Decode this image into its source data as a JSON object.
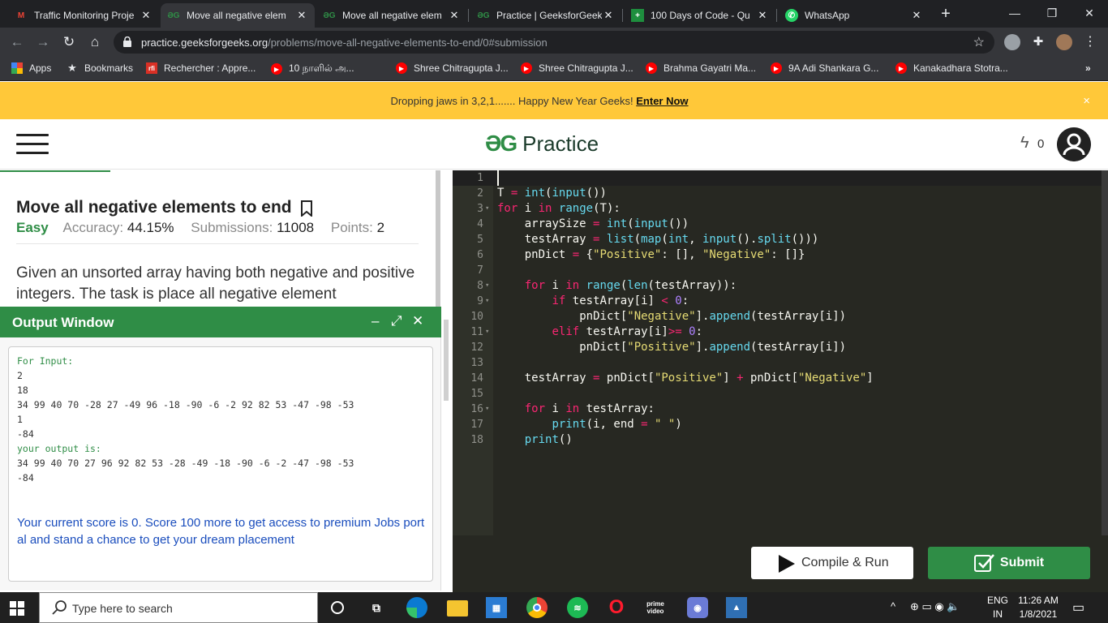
{
  "browser": {
    "tabs": [
      {
        "title": "Traffic Monitoring Proje",
        "favicon": "gmail-icon"
      },
      {
        "title": "Move all negative elem",
        "favicon": "gfg-icon"
      },
      {
        "title": "Move all negative elem",
        "favicon": "gfg-icon"
      },
      {
        "title": "Practice | GeeksforGeek",
        "favicon": "gfg-icon"
      },
      {
        "title": "100 Days of Code - Qu",
        "favicon": "plus-icon"
      },
      {
        "title": "WhatsApp",
        "favicon": "whatsapp-icon"
      }
    ],
    "url_host": "practice.geeksforgeeks.org",
    "url_path": "/problems/move-all-negative-elements-to-end/0#submission",
    "bookmarks": [
      {
        "label": "Apps",
        "icon": "apps-icon"
      },
      {
        "label": "Bookmarks",
        "icon": "star-icon"
      },
      {
        "label": "Rechercher : Appre...",
        "icon": "rfi-icon"
      },
      {
        "label": "10 நாளில் அ...",
        "icon": "youtube-icon"
      },
      {
        "label": "Shree Chitragupta J...",
        "icon": "youtube-icon"
      },
      {
        "label": "Shree Chitragupta J...",
        "icon": "youtube-icon"
      },
      {
        "label": "Brahma Gayatri Ma...",
        "icon": "youtube-icon"
      },
      {
        "label": "9A Adi Shankara G...",
        "icon": "youtube-icon"
      },
      {
        "label": "Kanakadhara Stotra...",
        "icon": "youtube-icon"
      }
    ],
    "more_bookmarks": "»"
  },
  "banner": {
    "text": "Dropping jaws in 3,2,1....... Happy New Year Geeks!",
    "link": "Enter Now",
    "close": "×"
  },
  "header": {
    "logo_mark": "ƏG",
    "logo_text": "Practice",
    "score": "0"
  },
  "problem": {
    "title": "Move all negative elements to end",
    "difficulty": "Easy",
    "accuracy_label": "Accuracy:",
    "accuracy_value": "44.15%",
    "submissions_label": "Submissions:",
    "submissions_value": "11008",
    "points_label": "Points:",
    "points_value": "2",
    "description": "Given an unsorted array having both negative and positive integers. The task is place all negative element"
  },
  "output_window": {
    "title": "Output Window",
    "controls": [
      "–",
      "⤢",
      "✕"
    ],
    "for_input_label": "For Input:",
    "input_lines": [
      "2",
      "18",
      "34 99 40 70 -28 27 -49 96 -18 -90 -6 -2 92 82 53 -47 -98 -53",
      "1",
      "-84"
    ],
    "your_output_label": "your output is:",
    "output_lines": [
      "34 99 40 70 27 96 92 82 53 -28 -49 -18 -90 -6 -2 -47 -98 -53",
      "-84"
    ],
    "score_message": "Your current score is 0. Score 100 more to get access to premium Jobs portal and stand a chance to get your dream placement"
  },
  "editor": {
    "lines": [
      "",
      "T = int(input())",
      "for i in range(T):",
      "    arraySize = int(input())",
      "    testArray = list(map(int, input().split()))",
      "    pnDict = {\"Positive\": [], \"Negative\": []}",
      "",
      "    for i in range(len(testArray)):",
      "        if testArray[i] < 0:",
      "            pnDict[\"Negative\"].append(testArray[i])",
      "        elif testArray[i]>= 0:",
      "            pnDict[\"Positive\"].append(testArray[i])",
      "",
      "    testArray = pnDict[\"Positive\"] + pnDict[\"Negative\"]",
      "",
      "    for i in testArray:",
      "        print(i, end = \" \")",
      "    print()"
    ],
    "fold_lines": [
      3,
      8,
      9,
      11,
      16
    ],
    "compile_label": "Compile & Run",
    "submit_label": "Submit"
  },
  "taskbar": {
    "search_placeholder": "Type here to search",
    "lang_top": "ENG",
    "lang_bottom": "IN",
    "time": "11:26 AM",
    "date": "1/8/2021",
    "apps": [
      "task-view-icon",
      "edge-icon",
      "file-explorer-icon",
      "store-icon",
      "chrome-icon",
      "spotify-icon",
      "opera-icon",
      "prime-video-icon",
      "camera-icon",
      "photos-icon"
    ],
    "prime_label": "prime video"
  },
  "colors": {
    "gfg_green": "#2f8d46",
    "banner_yellow": "#ffc839",
    "editor_bg": "#272822"
  }
}
